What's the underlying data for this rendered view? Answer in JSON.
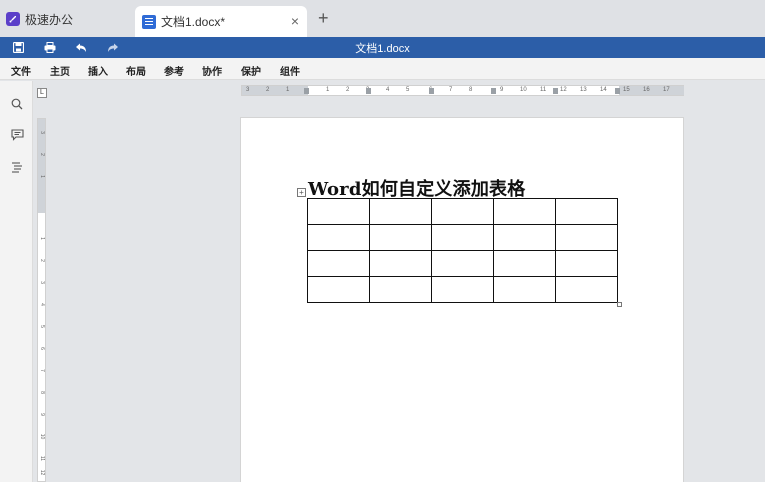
{
  "tabs": {
    "app_label": "极速办公",
    "document_tab_label": "文档1.docx*",
    "close_symbol": "×",
    "new_tab_symbol": "+"
  },
  "titlebar": {
    "document_title": "文档1.docx"
  },
  "menu": {
    "items": [
      "文件",
      "主页",
      "插入",
      "布局",
      "参考",
      "协作",
      "保护",
      "组件"
    ]
  },
  "ruler": {
    "corner_label": "L",
    "horizontal_numbers": [
      "3",
      "2",
      "1",
      "1",
      "2",
      "3",
      "4",
      "5",
      "6",
      "7",
      "8",
      "9",
      "10",
      "11",
      "12",
      "13",
      "14",
      "15",
      "16",
      "17"
    ],
    "vertical_numbers": [
      "3",
      "2",
      "1",
      "1",
      "2",
      "3",
      "4",
      "5",
      "6",
      "7",
      "8",
      "9",
      "10",
      "11",
      "12",
      "13"
    ]
  },
  "document": {
    "heading": "Word如何自定义添加表格",
    "table": {
      "rows": 4,
      "columns": 5
    }
  },
  "colors": {
    "titlebar": "#2c5ea8",
    "app_logo": "#5b3fc9",
    "doc_icon": "#2f6bd6"
  },
  "icons": {
    "app": "rocket-icon",
    "doc": "document-icon",
    "save": "save-icon",
    "print": "print-icon",
    "undo": "undo-icon",
    "redo": "redo-icon",
    "search": "search-icon",
    "comments": "comment-icon",
    "navigation": "outline-icon"
  }
}
